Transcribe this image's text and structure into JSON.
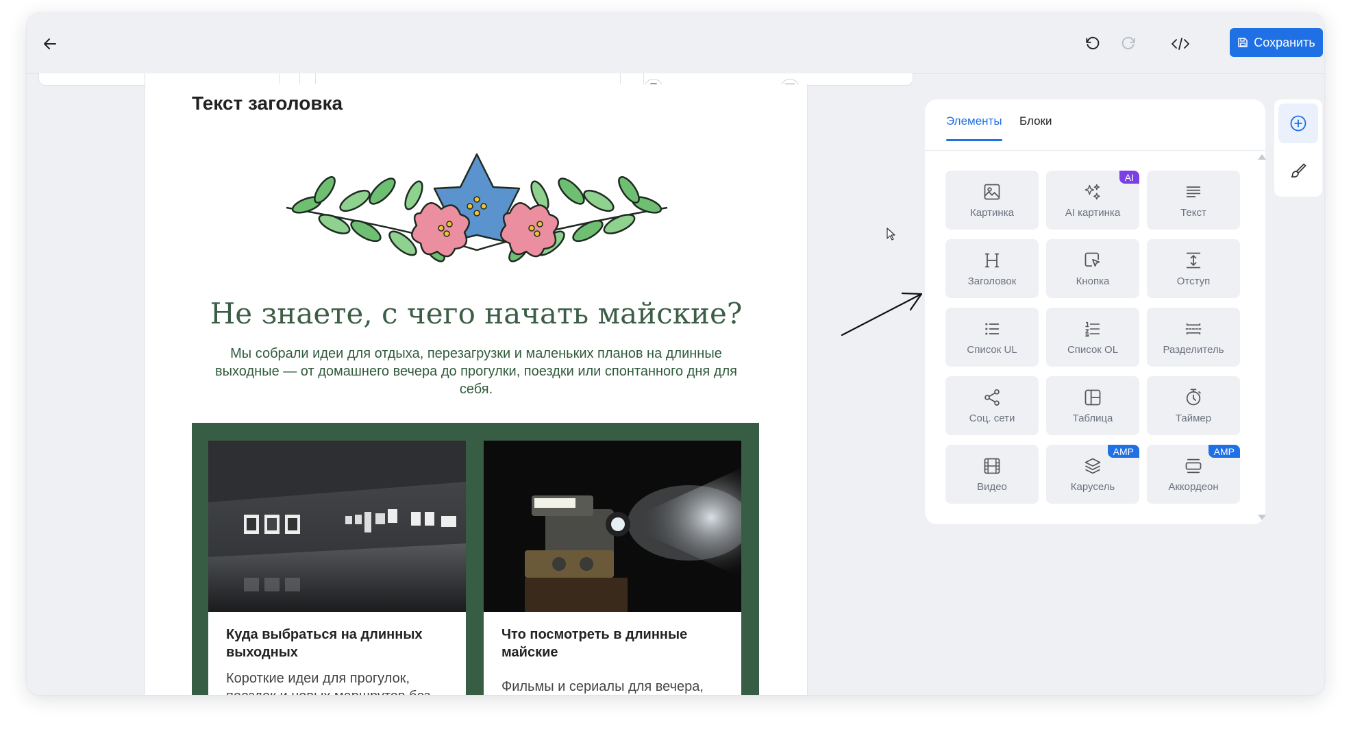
{
  "toolbar": {
    "save_label": "Сохранить",
    "icons": [
      "arrow-left-icon",
      "undo-icon",
      "redo-icon",
      "code-icon",
      "save-icon"
    ]
  },
  "email": {
    "title": "Текст заголовка",
    "headline": "Не знаете, с чего начать майские?",
    "lead": "Мы собрали идеи для отдыха, перезагрузки и маленьких планов на длинные выходные — от домашнего вечера до прогулки, поездки или спонтанного дня для себя.",
    "cards": [
      {
        "image": "gallery-photo",
        "title": "Куда выбраться на длинных выходных",
        "text": "Короткие идеи для прогулок, поездок и новых маршрутов без"
      },
      {
        "image": "projector-photo",
        "title": "Что посмотреть в длинные майские",
        "text": "Фильмы и сериалы для вечера,"
      }
    ],
    "colors": {
      "headline": "#3c5e46",
      "block_bg": "#375d45"
    }
  },
  "panel": {
    "tabs": [
      {
        "label": "Элементы",
        "active": true
      },
      {
        "label": "Блоки",
        "active": false
      }
    ],
    "elements": [
      {
        "label": "Картинка",
        "icon": "image-icon"
      },
      {
        "label": "AI картинка",
        "icon": "sparkles-icon",
        "badge": "AI"
      },
      {
        "label": "Текст",
        "icon": "text-lines-icon"
      },
      {
        "label": "Заголовок",
        "icon": "heading-icon"
      },
      {
        "label": "Кнопка",
        "icon": "button-cursor-icon"
      },
      {
        "label": "Отступ",
        "icon": "spacer-icon"
      },
      {
        "label": "Список UL",
        "icon": "bullet-list-icon"
      },
      {
        "label": "Список OL",
        "icon": "numbered-list-icon"
      },
      {
        "label": "Разделитель",
        "icon": "divider-icon"
      },
      {
        "label": "Соц. сети",
        "icon": "share-icon"
      },
      {
        "label": "Таблица",
        "icon": "table-icon"
      },
      {
        "label": "Таймер",
        "icon": "timer-icon"
      },
      {
        "label": "Видео",
        "icon": "video-icon"
      },
      {
        "label": "Карусель",
        "icon": "layers-icon",
        "badge": "AMP"
      },
      {
        "label": "Аккордеон",
        "icon": "accordion-icon",
        "badge": "AMP"
      }
    ],
    "badge_colors": {
      "AI": "#7b3fe4",
      "AMP": "#1f6fe5"
    },
    "accent": "#1f6fe5"
  },
  "side_toolbar": {
    "items": [
      {
        "icon": "add-circle-icon",
        "active": true
      },
      {
        "icon": "brush-icon",
        "active": false
      }
    ]
  }
}
